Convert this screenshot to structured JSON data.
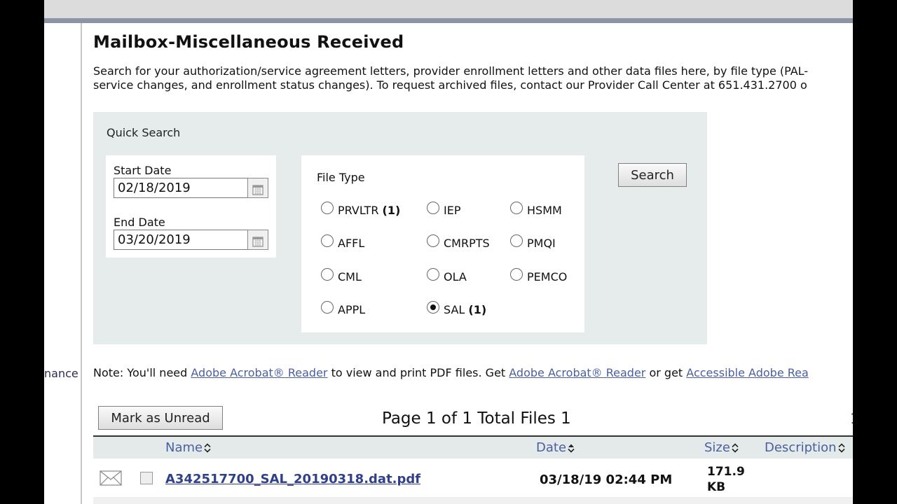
{
  "side_fragment": "nance",
  "page": {
    "title": "Mailbox-Miscellaneous Received",
    "description_line1": "Search for your authorization/service agreement letters, provider enrollment letters and other data files here, by file type (PAL-",
    "description_line2": "service changes, and enrollment status changes). To request archived files, contact our Provider Call Center at 651.431.2700 o"
  },
  "quick_search": {
    "label": "Quick Search",
    "start_date_label": "Start Date",
    "start_date_value": "02/18/2019",
    "end_date_label": "End Date",
    "end_date_value": "03/20/2019",
    "file_type_label": "File Type",
    "file_types": [
      {
        "label": "PRVLTR",
        "count": "(1)",
        "checked": false
      },
      {
        "label": "IEP",
        "count": "",
        "checked": false
      },
      {
        "label": "HSMM",
        "count": "",
        "checked": false
      },
      {
        "label": "AFFL",
        "count": "",
        "checked": false
      },
      {
        "label": "CMRPTS",
        "count": "",
        "checked": false
      },
      {
        "label": "PMQI",
        "count": "",
        "checked": false
      },
      {
        "label": "CML",
        "count": "",
        "checked": false
      },
      {
        "label": "OLA",
        "count": "",
        "checked": false
      },
      {
        "label": "PEMCO",
        "count": "",
        "checked": false
      },
      {
        "label": "APPL",
        "count": "",
        "checked": false
      },
      {
        "label": "SAL",
        "count": "(1)",
        "checked": true
      }
    ],
    "search_button": "Search"
  },
  "note": {
    "prefix": "Note: You'll need ",
    "link1": "Adobe Acrobat® Reader",
    "middle": " to view and print PDF files. Get ",
    "link2": "Adobe Acrobat® Reader",
    "middle2": " or get ",
    "link3": "Accessible Adobe Rea"
  },
  "toolbar": {
    "mark_unread_button": "Mark as Unread",
    "page_info": "Page 1 of 1 Total Files 1",
    "edge_fragment": "1"
  },
  "table": {
    "columns": {
      "name": "Name",
      "date": "Date",
      "size": "Size",
      "description": "Description"
    },
    "rows": [
      {
        "name": "A342517700_SAL_20190318.dat.pdf",
        "date": "03/18/19 02:44 PM",
        "size": "171.9 KB",
        "description": ""
      }
    ]
  },
  "colors": {
    "link": "#4a5fa0",
    "panel_bg": "#e6ecec",
    "header_bar": "#8d92a5"
  }
}
